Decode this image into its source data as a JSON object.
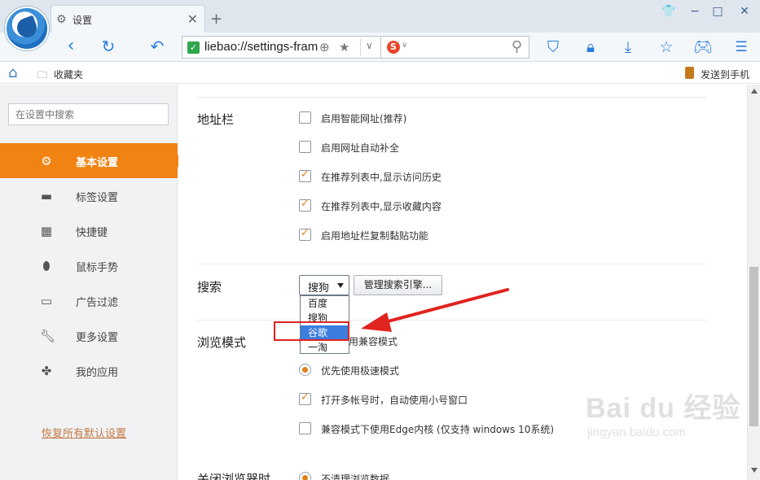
{
  "tab": {
    "title": "设置",
    "close": "✕",
    "new_tab": "+"
  },
  "window": {
    "skin": "👕",
    "minimize": "−",
    "maximize": "□",
    "close": "✕"
  },
  "toolbar": {
    "url": "liebao://settings-frame/",
    "search_engine_letter": "S"
  },
  "bookmarks": {
    "folder_label": "收藏夹",
    "send_label": "发送到手机"
  },
  "sidebar": {
    "search_placeholder": "在设置中搜索",
    "items": [
      {
        "label": "基本设置",
        "icon": "gear-icon",
        "active": true
      },
      {
        "label": "标签设置",
        "icon": "tab-icon",
        "active": false
      },
      {
        "label": "快捷键",
        "icon": "keyboard-icon",
        "active": false
      },
      {
        "label": "鼠标手势",
        "icon": "mouse-icon",
        "active": false
      },
      {
        "label": "广告过滤",
        "icon": "window-icon",
        "active": false
      },
      {
        "label": "更多设置",
        "icon": "wrench-icon",
        "active": false
      },
      {
        "label": "我的应用",
        "icon": "puzzle-icon",
        "active": false
      }
    ],
    "reset_link": "恢复所有默认设置"
  },
  "address_bar": {
    "title": "地址栏",
    "options": [
      {
        "label": "启用智能网址(推荐)",
        "checked": false
      },
      {
        "label": "启用网址自动补全",
        "checked": false
      },
      {
        "label": "在推荐列表中,显示访问历史",
        "checked": true
      },
      {
        "label": "在推荐列表中,显示收藏内容",
        "checked": true
      },
      {
        "label": "启用地址栏复制黏贴功能",
        "checked": true
      }
    ]
  },
  "search": {
    "title": "搜索",
    "selected": "搜狗",
    "manage_button": "管理搜索引擎...",
    "options": [
      "百度",
      "搜狗",
      "谷歌",
      "一淘"
    ],
    "highlighted": "谷歌"
  },
  "browse_mode": {
    "title": "浏览模式",
    "options": [
      {
        "type": "radio",
        "label": "用兼容模式",
        "checked": false
      },
      {
        "type": "radio",
        "label": "优先使用极速模式",
        "checked": true
      },
      {
        "type": "checkbox",
        "label": "打开多帐号时，自动使用小号窗口",
        "checked": true
      },
      {
        "type": "checkbox",
        "label": "兼容模式下使用Edge内核 (仅支持 windows 10系统)",
        "checked": false
      }
    ]
  },
  "close_browser": {
    "title": "关闭浏览器时",
    "option": "不清理浏览数据"
  },
  "watermark": {
    "brand": "Bai du 经验",
    "sub": "jingyan.baidu.com"
  },
  "colors": {
    "accent": "#f08312",
    "brand_blue": "#2b7de0",
    "highlight": "#3b7ddd",
    "annotation_red": "#e0241f"
  }
}
